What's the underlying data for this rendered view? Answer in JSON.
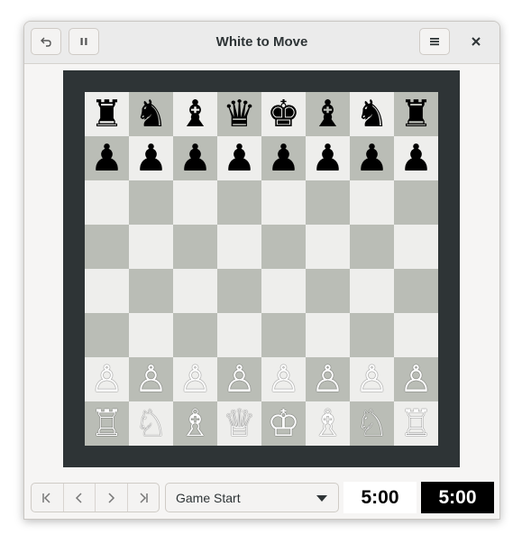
{
  "window": {
    "title": "White to Move"
  },
  "header": {
    "undo_icon": "undo-icon",
    "pause_icon": "pause-icon",
    "menu_icon": "hamburger-menu-icon",
    "close_icon": "close-icon"
  },
  "board": {
    "colors": {
      "light": "#eeeeec",
      "dark": "#babdb6",
      "frame": "#2e3436"
    },
    "rows": [
      [
        "♜",
        "♞",
        "♝",
        "♛",
        "♚",
        "♝",
        "♞",
        "♜"
      ],
      [
        "♟",
        "♟",
        "♟",
        "♟",
        "♟",
        "♟",
        "♟",
        "♟"
      ],
      [
        "",
        "",
        "",
        "",
        "",
        "",
        "",
        ""
      ],
      [
        "",
        "",
        "",
        "",
        "",
        "",
        "",
        ""
      ],
      [
        "",
        "",
        "",
        "",
        "",
        "",
        "",
        ""
      ],
      [
        "",
        "",
        "",
        "",
        "",
        "",
        "",
        ""
      ],
      [
        "♙",
        "♙",
        "♙",
        "♙",
        "♙",
        "♙",
        "♙",
        "♙"
      ],
      [
        "♖",
        "♘",
        "♗",
        "♕",
        "♔",
        "♗",
        "♘",
        "♖"
      ]
    ]
  },
  "history": {
    "nav_icons": [
      "first-move-icon",
      "previous-move-icon",
      "next-move-icon",
      "last-move-icon"
    ],
    "selected": "Game Start"
  },
  "clocks": {
    "white": "5:00",
    "black": "5:00"
  }
}
